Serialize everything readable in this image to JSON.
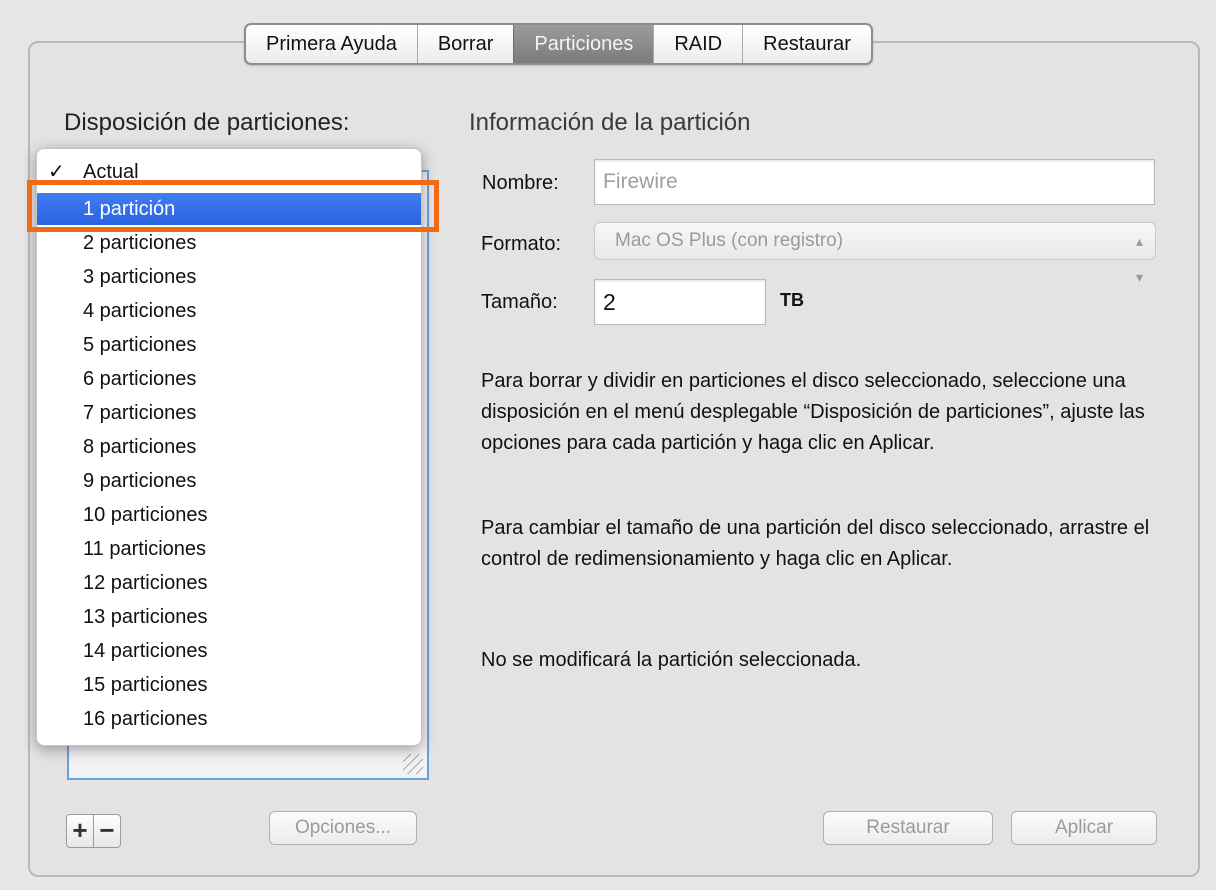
{
  "tabs": [
    "Primera Ayuda",
    "Borrar",
    "Particiones",
    "RAID",
    "Restaurar"
  ],
  "selected_tab": "Particiones",
  "layout": {
    "heading": "Disposición de particiones:",
    "current_label": "Actual",
    "check_mark": "✓",
    "options": [
      "1 partición",
      "2 particiones",
      "3 particiones",
      "4 particiones",
      "5 particiones",
      "6 particiones",
      "7 particiones",
      "8 particiones",
      "9 particiones",
      "10 particiones",
      "11 particiones",
      "12 particiones",
      "13 particiones",
      "14 particiones",
      "15 particiones",
      "16 particiones"
    ],
    "highlighted_option": "1 partición"
  },
  "info": {
    "heading": "Información de la partición",
    "name_label": "Nombre:",
    "name_value": "Firewire",
    "format_label": "Formato:",
    "format_value": "Mac OS Plus (con registro)",
    "size_label": "Tamaño:",
    "size_value": "2",
    "size_unit": "TB"
  },
  "help": {
    "para1": "Para borrar y dividir en particiones el disco seleccionado, seleccione una disposición en el menú desplegable “Disposición de particiones”, ajuste las opciones para cada partición y haga clic en Aplicar.",
    "para2": "Para cambiar el tamaño de una partición del disco seleccionado, arrastre el control de redimensionamiento y haga clic en Aplicar.",
    "para3": "No se modificará la partición seleccionada."
  },
  "buttons": {
    "add": "+",
    "remove": "−",
    "options": "Opciones...",
    "restore": "Restaurar",
    "apply": "Aplicar"
  },
  "colors": {
    "highlight_blue": "#2f6fe8",
    "annotation_orange": "#f26a14"
  }
}
